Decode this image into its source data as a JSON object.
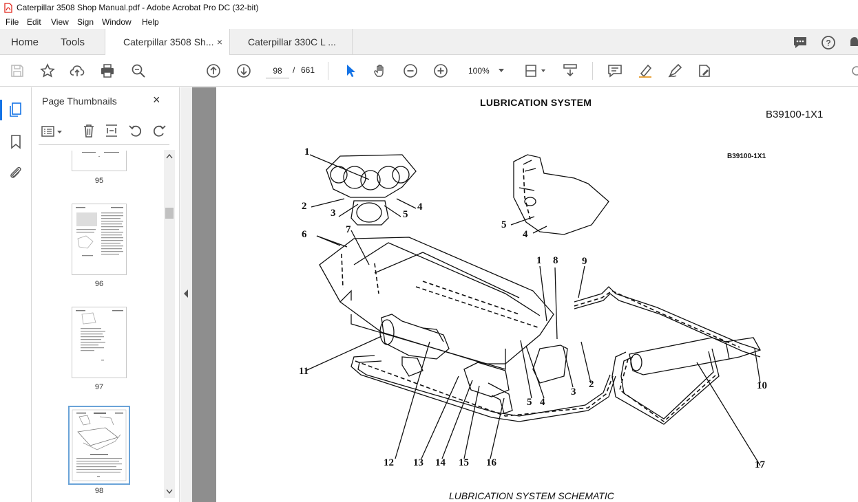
{
  "window": {
    "title": "Caterpillar 3508 Shop Manual.pdf - Adobe Acrobat Pro DC (32-bit)"
  },
  "menu": {
    "items": [
      "File",
      "Edit",
      "View",
      "Sign",
      "Window",
      "Help"
    ]
  },
  "tabs": {
    "home": "Home",
    "tools": "Tools",
    "doc1": "Caterpillar 3508 Sh...",
    "doc1_close": "×",
    "doc2": "Caterpillar 330C L ..."
  },
  "toolbar": {
    "current_page": "98",
    "page_separator": "/",
    "total_pages": "661",
    "zoom": "100%"
  },
  "panel": {
    "title": "Page Thumbnails",
    "close": "×",
    "thumbnails": [
      {
        "label": "95"
      },
      {
        "label": "96"
      },
      {
        "label": "97"
      },
      {
        "label": "98"
      }
    ]
  },
  "document": {
    "title": "LUBRICATION SYSTEM",
    "code": "B39100-1X1",
    "figure_code": "B39100-1X1",
    "caption": "LUBRICATION SYSTEM SCHEMATIC",
    "callouts": [
      "1",
      "2",
      "3",
      "4",
      "5",
      "6",
      "7",
      "1",
      "8",
      "9",
      "11",
      "5",
      "4",
      "3",
      "2",
      "10",
      "12",
      "13",
      "14",
      "15",
      "16",
      "17",
      "2",
      "3",
      "4",
      "5",
      "5",
      "4"
    ]
  },
  "colors": {
    "accent": "#1473e6",
    "pdf_red": "#e0261c",
    "doc_gray": "#8e8e8e"
  }
}
